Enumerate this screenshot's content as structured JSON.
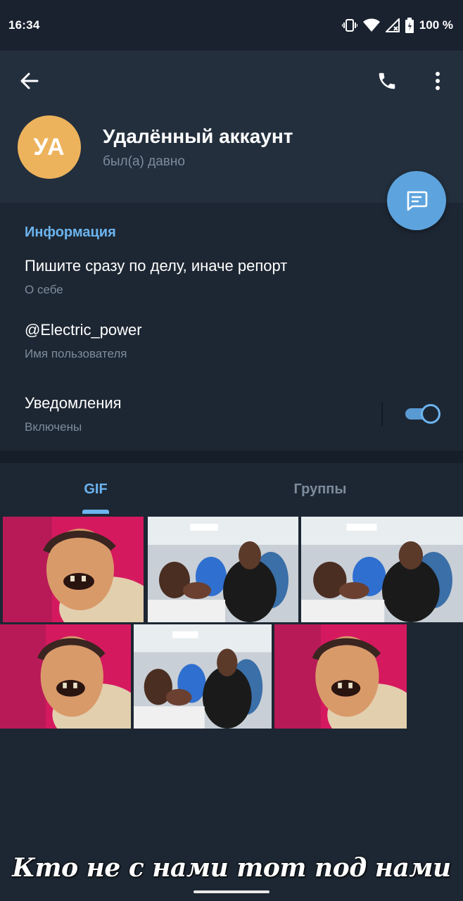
{
  "status_bar": {
    "time": "16:34",
    "battery_text": "100 %",
    "icons": [
      "vibrate-icon",
      "wifi-icon",
      "signal-icon",
      "battery-icon"
    ]
  },
  "header": {
    "back_icon": "arrow-left-icon",
    "call_icon": "phone-icon",
    "more_icon": "more-vertical-icon",
    "avatar_initials": "УА",
    "avatar_color": "#edb35c",
    "name": "Удалённый аккаунт",
    "status": "был(а) давно",
    "fab_icon": "message-icon"
  },
  "info": {
    "title": "Информация",
    "bio": "Пишите сразу по делу, иначе репорт",
    "bio_label": "О себе",
    "username": "@Electric_power",
    "username_label": "Имя пользователя",
    "notifications": "Уведомления",
    "notifications_status": "Включены",
    "notifications_on": true
  },
  "tabs": [
    {
      "label": "GIF",
      "active": true
    },
    {
      "label": "Группы",
      "active": false
    }
  ],
  "gifs": [
    "laughing-man-gif",
    "laughing-crowd-gif",
    "laughing-crowd-gif",
    "laughing-man-gif",
    "laughing-crowd-gif",
    "laughing-man-gif"
  ],
  "caption": "Кто не с нами тот под нами",
  "colors": {
    "accent": "#6cb4ef",
    "fab": "#5da4de",
    "background": "#1d2733",
    "header": "#232f3d"
  }
}
